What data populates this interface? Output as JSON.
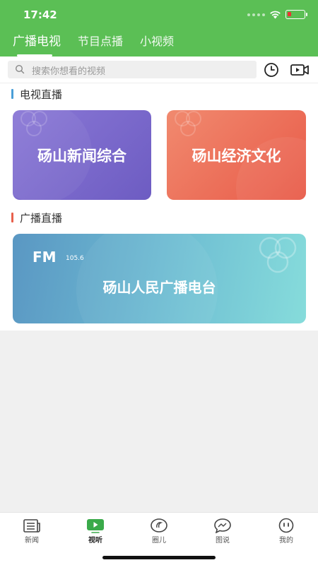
{
  "status": {
    "time": "17:42"
  },
  "tabs": [
    {
      "label": "广播电视",
      "active": true
    },
    {
      "label": "节目点播",
      "active": false
    },
    {
      "label": "小视频",
      "active": false
    }
  ],
  "search": {
    "placeholder": "搜索你想看的视频"
  },
  "sections": {
    "tv": {
      "title": "电视直播",
      "accent": "#4a9fd8"
    },
    "radio": {
      "title": "广播直播",
      "accent": "#e8604c"
    }
  },
  "tv_channels": [
    {
      "name": "砀山新闻综合",
      "colors": [
        "#8a78d6",
        "#6d5cc2"
      ]
    },
    {
      "name": "砀山经济文化",
      "colors": [
        "#f18a6f",
        "#e85a48"
      ]
    }
  ],
  "radio_channel": {
    "fm": "FM",
    "frequency": "105.6",
    "name": "砀山人民广播电台"
  },
  "bottom_nav": [
    {
      "label": "新闻",
      "icon": "newspaper-icon",
      "active": false
    },
    {
      "label": "视听",
      "icon": "play-icon",
      "active": true
    },
    {
      "label": "圈儿",
      "icon": "chat-bubble-icon",
      "active": false
    },
    {
      "label": "图说",
      "icon": "speech-image-icon",
      "active": false
    },
    {
      "label": "我的",
      "icon": "smiley-face-icon",
      "active": false
    }
  ],
  "colors": {
    "brand": "#5bbf55",
    "nav_active": "#3aaa4a"
  }
}
